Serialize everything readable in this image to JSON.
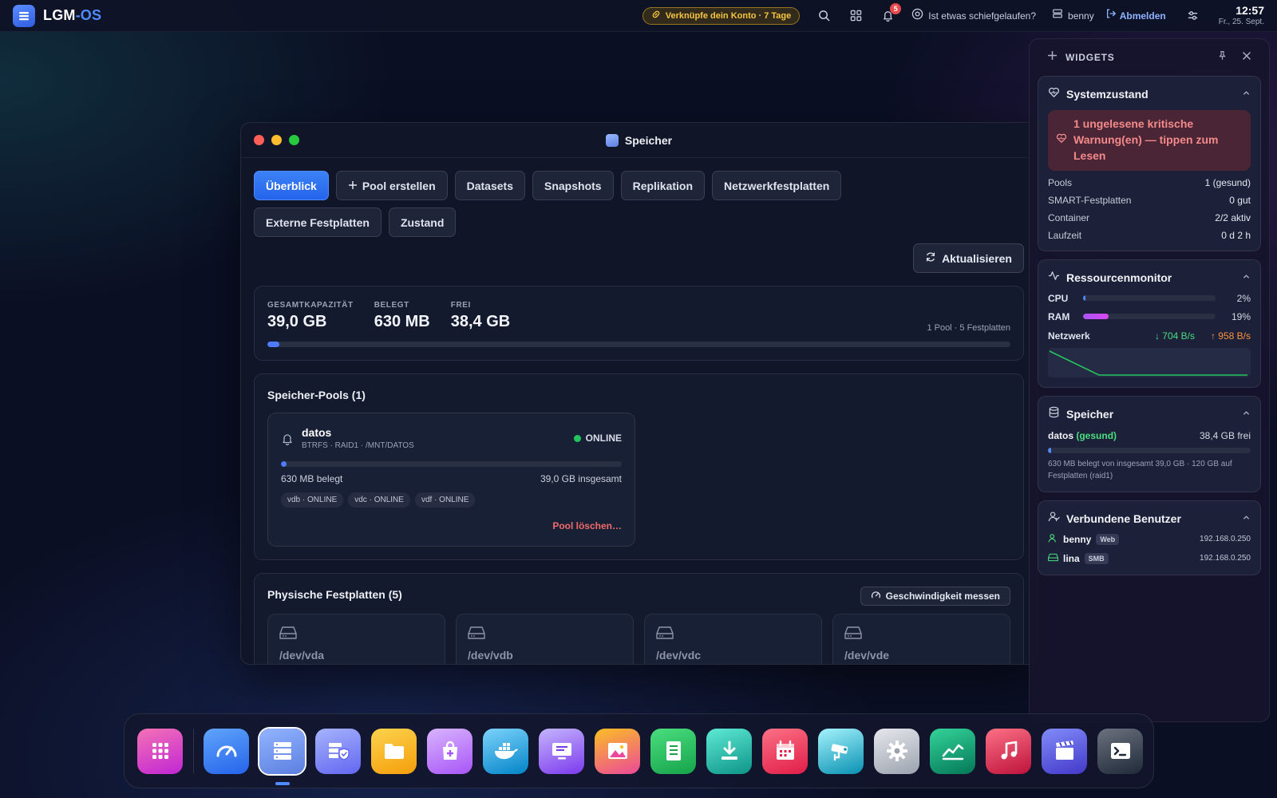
{
  "topbar": {
    "brand_a": "LGM",
    "brand_b": "-OS",
    "link_pill": "Verknüpfe dein Konto · 7 Tage",
    "notif_count": "5",
    "help": "Ist etwas schiefgelaufen?",
    "user": "benny",
    "logout": "Abmelden",
    "time": "12:57",
    "date": "Fr., 25. Sept."
  },
  "window": {
    "title": "Speicher",
    "tabs": [
      {
        "label": "Überblick",
        "active": true
      },
      {
        "label": "Pool erstellen"
      },
      {
        "label": "Datasets"
      },
      {
        "label": "Snapshots"
      },
      {
        "label": "Replikation"
      },
      {
        "label": "Netzwerkfestplatten"
      },
      {
        "label": "Externe Festplatten"
      },
      {
        "label": "Zustand"
      }
    ],
    "refresh": "Aktualisieren",
    "capacity": {
      "total_label": "GESAMTKAPAZITÄT",
      "total": "39,0 GB",
      "used_label": "BELEGT",
      "used": "630 MB",
      "free_label": "FREI",
      "free": "38,4 GB",
      "summary": "1 Pool · 5 Festplatten",
      "used_fraction": 0.016
    },
    "pools": {
      "title": "Speicher-Pools (1)",
      "items": [
        {
          "name": "datos",
          "meta": "BTRFS · RAID1 · /MNT/DATOS",
          "status": "ONLINE",
          "used": "630 MB belegt",
          "total": "39,0 GB insgesamt",
          "used_fraction": 0.016,
          "disks": [
            "vdb · ONLINE",
            "vdc · ONLINE",
            "vdf · ONLINE"
          ],
          "delete": "Pool löschen…"
        }
      ]
    },
    "disks": {
      "title": "Physische Festplatten (5)",
      "speed_button": "Geschwindigkeit messen",
      "items": [
        "/dev/vda",
        "/dev/vdb",
        "/dev/vdc",
        "/dev/vde"
      ]
    }
  },
  "widgets": {
    "title": "WIDGETS",
    "health": {
      "title": "Systemzustand",
      "alert": "1 ungelesene kritische Warnung(en) — tippen zum Lesen",
      "rows": [
        {
          "k": "Pools",
          "v": "1 (gesund)"
        },
        {
          "k": "SMART-Festplatten",
          "v": "0 gut"
        },
        {
          "k": "Container",
          "v": "2/2 aktiv"
        },
        {
          "k": "Laufzeit",
          "v": "0 d 2 h"
        }
      ]
    },
    "resources": {
      "title": "Ressourcenmonitor",
      "cpu_label": "CPU",
      "cpu": "2%",
      "cpu_fraction": 0.02,
      "ram_label": "RAM",
      "ram": "19%",
      "ram_fraction": 0.19,
      "net_label": "Netzwerk",
      "net_down": "↓ 704 B/s",
      "net_up": "↑ 958 B/s"
    },
    "storage": {
      "title": "Speicher",
      "pool": "datos",
      "state": "(gesund)",
      "free": "38,4 GB frei",
      "used_fraction": 0.016,
      "note": "630 MB belegt von insgesamt 39,0 GB · 120 GB auf Festplatten (raid1)"
    },
    "users": {
      "title": "Verbundene Benutzer",
      "items": [
        {
          "name": "benny",
          "tag": "Web",
          "ip": "192.168.0.250"
        },
        {
          "name": "lina",
          "tag": "SMB",
          "ip": "192.168.0.250"
        }
      ]
    }
  },
  "dock": {
    "items": [
      "launcher",
      "dashboard",
      "storage",
      "security",
      "files",
      "app-store",
      "docker",
      "remote-desktop",
      "photos",
      "notes",
      "downloads",
      "calendar",
      "cameras",
      "settings",
      "monitor",
      "music",
      "video",
      "terminal"
    ],
    "active": "storage"
  }
}
